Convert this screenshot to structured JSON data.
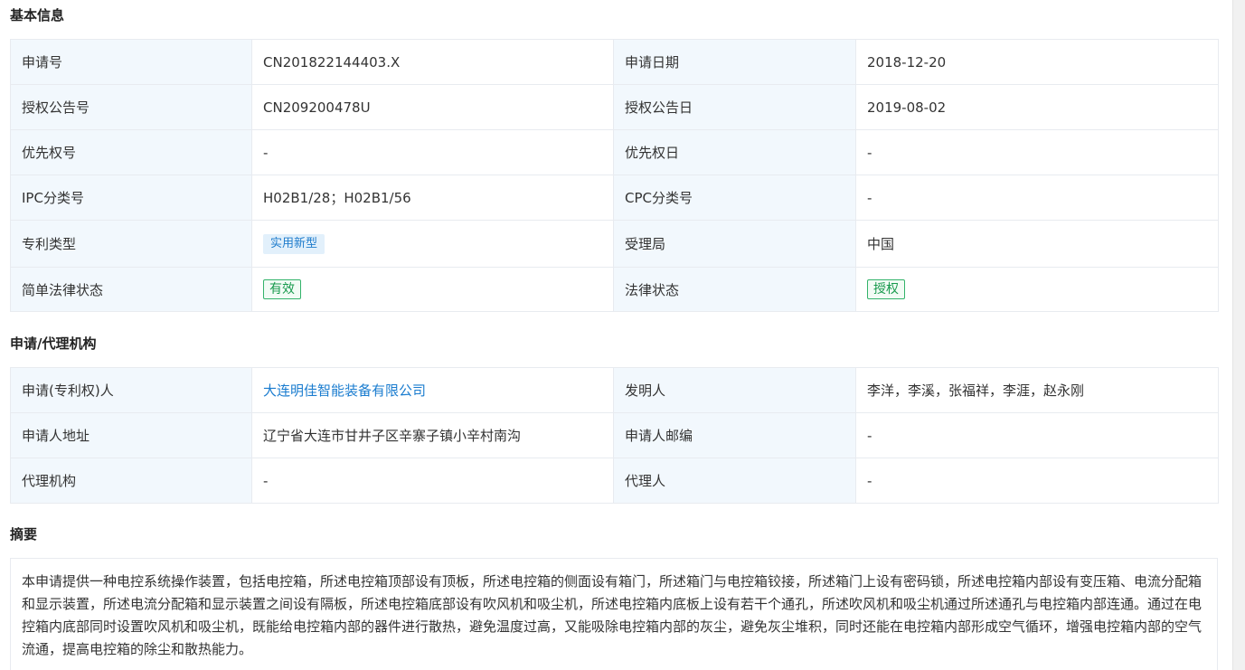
{
  "basic_info": {
    "title": "基本信息",
    "rows": [
      {
        "l1": "申请号",
        "v1": "CN201822144403.X",
        "l2": "申请日期",
        "v2": "2018-12-20"
      },
      {
        "l1": "授权公告号",
        "v1": "CN209200478U",
        "l2": "授权公告日",
        "v2": "2019-08-02"
      },
      {
        "l1": "优先权号",
        "v1": "-",
        "l2": "优先权日",
        "v2": "-"
      },
      {
        "l1": "IPC分类号",
        "v1": "H02B1/28；H02B1/56",
        "l2": "CPC分类号",
        "v2": "-"
      },
      {
        "l1": "专利类型",
        "v1": "实用新型",
        "l2": "受理局",
        "v2": "中国"
      },
      {
        "l1": "简单法律状态",
        "v1": "有效",
        "l2": "法律状态",
        "v2": "授权"
      }
    ]
  },
  "agency_info": {
    "title": "申请/代理机构",
    "rows": [
      {
        "l1": "申请(专利权)人",
        "v1": "大连明佳智能装备有限公司",
        "l2": "发明人",
        "v2": "李洋，李溪，张福祥，李涯，赵永刚"
      },
      {
        "l1": "申请人地址",
        "v1": "辽宁省大连市甘井子区辛寨子镇小辛村南沟",
        "l2": "申请人邮编",
        "v2": "-"
      },
      {
        "l1": "代理机构",
        "v1": "-",
        "l2": "代理人",
        "v2": "-"
      }
    ]
  },
  "abstract": {
    "title": "摘要",
    "text": "本申请提供一种电控系统操作装置，包括电控箱，所述电控箱顶部设有顶板，所述电控箱的侧面设有箱门，所述箱门与电控箱铰接，所述箱门上设有密码锁，所述电控箱内部设有变压箱、电流分配箱和显示装置，所述电流分配箱和显示装置之间设有隔板，所述电控箱底部设有吹风机和吸尘机，所述电控箱内底板上设有若干个通孔，所述吹风机和吸尘机通过所述通孔与电控箱内部连通。通过在电控箱内底部同时设置吹风机和吸尘机，既能给电控箱内部的器件进行散热，避免温度过高，又能吸除电控箱内部的灰尘，避免灰尘堆积，同时还能在电控箱内部形成空气循环，增强电控箱内部的空气流通，提高电控箱的除尘和散热能力。"
  },
  "colors": {
    "label_bg": "#f2f8fd",
    "border": "#e8ebf0",
    "link": "#1a7ccf",
    "tag_blue_bg": "#e2f0fb",
    "tag_green": "#189a4d"
  }
}
